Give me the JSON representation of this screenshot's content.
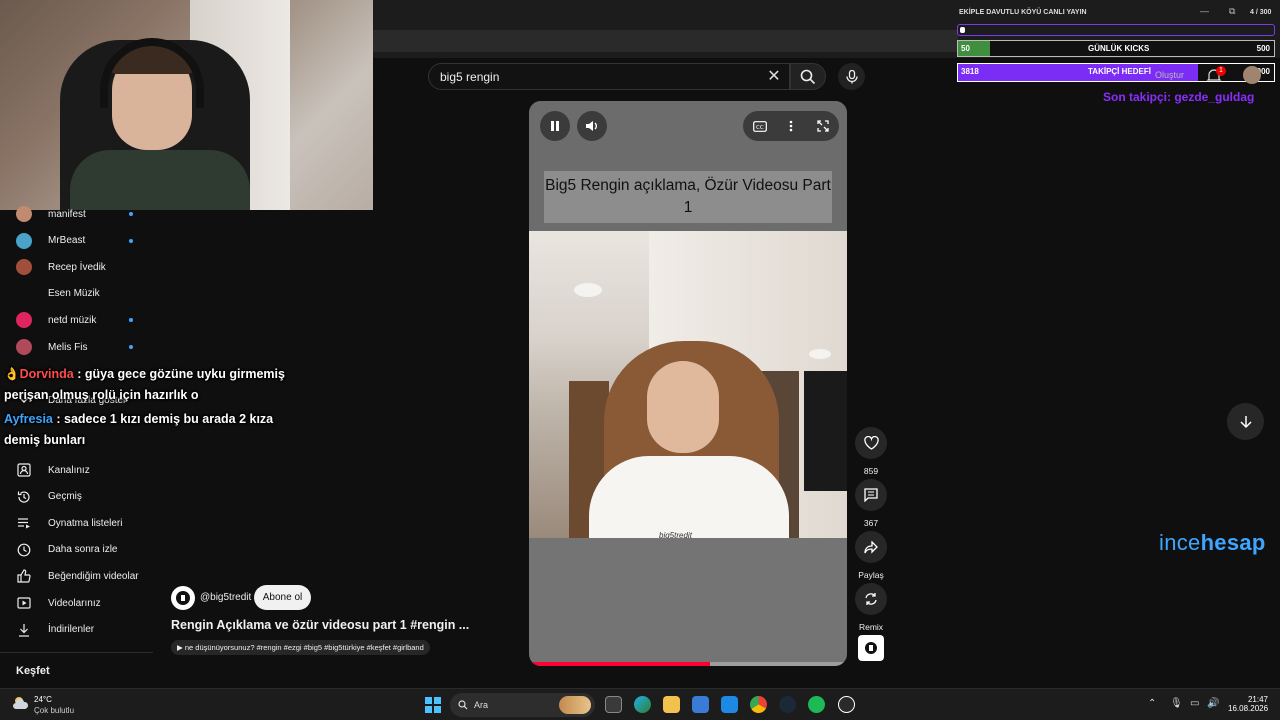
{
  "search": {
    "query": "big5 rengin"
  },
  "sidebar": {
    "subscriptions": [
      {
        "name": "manifest",
        "color": "#c28a6e",
        "dot": true
      },
      {
        "name": "MrBeast",
        "color": "#4aa3c8",
        "dot": true
      },
      {
        "name": "Recep İvedik",
        "color": "#a0503a",
        "dot": false
      },
      {
        "name": "Esen Müzik",
        "color": "#0f0f0f",
        "dot": false
      },
      {
        "name": "netd müzik",
        "color": "#e0245e",
        "dot": true
      },
      {
        "name": "Melis Fis",
        "color": "#b04a5a",
        "dot": true
      }
    ],
    "show_more": "Daha fazla göster",
    "you_items": [
      {
        "label": "Kanalınız",
        "icon": "channel-icon"
      },
      {
        "label": "Geçmiş",
        "icon": "history-icon"
      },
      {
        "label": "Oynatma listeleri",
        "icon": "playlist-icon"
      },
      {
        "label": "Daha sonra izle",
        "icon": "clock-icon"
      },
      {
        "label": "Beğendiğim videolar",
        "icon": "thumbs-up-icon"
      },
      {
        "label": "Videolarınız",
        "icon": "video-icon"
      },
      {
        "label": "İndirilenler",
        "icon": "download-icon"
      }
    ],
    "explore_title": "Keşfet"
  },
  "chat": [
    {
      "user": "Dorvinda",
      "message": ": güya gece gözüne uyku girmemiş perişan olmuş rolü için hazırlık o"
    },
    {
      "user": "Ayfresia",
      "message": ": sadece 1 kızı demiş bu arada 2 kıza demiş bunları"
    }
  ],
  "player": {
    "overlay_title": "Big5 Rengin açıklama, Özür Videosu Part 1",
    "watermark": "big5tredit",
    "progress": 0.57
  },
  "actions": {
    "likes": "859",
    "comments": "367",
    "share": "Paylaş",
    "remix": "Remix"
  },
  "video": {
    "channel": "@big5tredit",
    "subscribe": "Abone ol",
    "title": "Rengin Açıklama ve özür videosu part 1 #rengin ...",
    "tags": "▶ ne düşünüyorsunuz? #rengin #ezgi #big5 #big5türkiye #keşfet #girlband"
  },
  "overlay": {
    "stream_title": "EKİPLE DAVUTLU KÖYÜ CANLI YAYIN",
    "stream_count": "4 / 300",
    "kicks_value": "50",
    "kicks_label": "GÜNLÜK KICKS",
    "kicks_goal": "500",
    "kicks_progress": 0.1,
    "follow_value": "3818",
    "follow_label": "TAKİPÇİ HEDEFİ",
    "follow_goal": "5000",
    "follow_progress": 0.76,
    "last_follower": "Son takipçi: gezde_guldag",
    "create_label": "Oluştur",
    "notif_count": "1"
  },
  "brand": {
    "part1": "ince",
    "part2": "hesap"
  },
  "taskbar": {
    "temp": "24°C",
    "weather": "Çok bulutlu",
    "search": "Ara",
    "time": "21:47",
    "date": "16.08.2026"
  }
}
